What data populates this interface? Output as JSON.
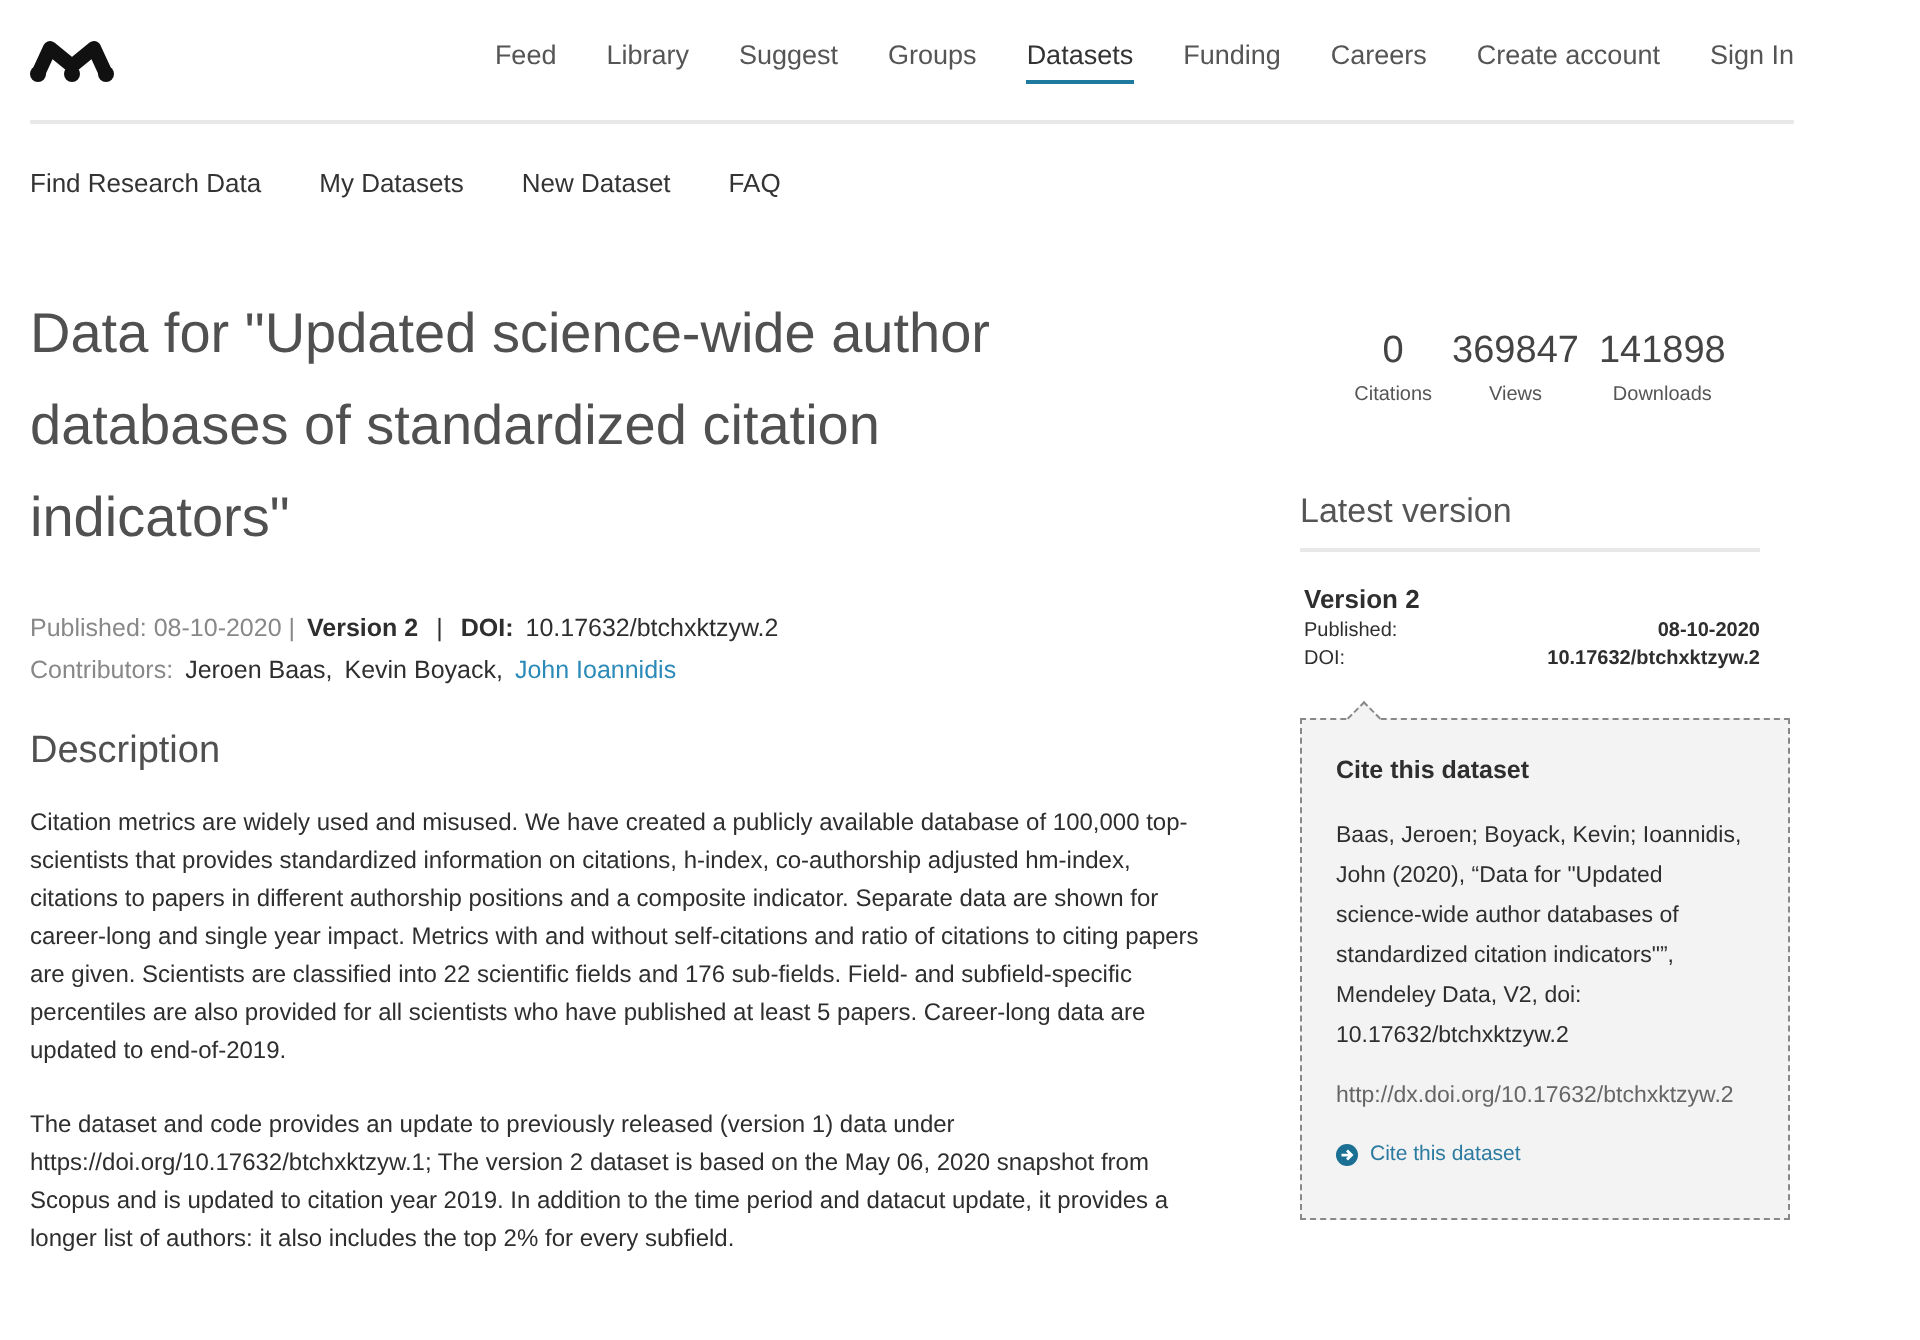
{
  "nav": [
    {
      "label": "Feed",
      "selected": false
    },
    {
      "label": "Library",
      "selected": false
    },
    {
      "label": "Suggest",
      "selected": false
    },
    {
      "label": "Groups",
      "selected": false
    },
    {
      "label": "Datasets",
      "selected": true
    },
    {
      "label": "Funding",
      "selected": false
    },
    {
      "label": "Careers",
      "selected": false
    },
    {
      "label": "Create account",
      "selected": false
    },
    {
      "label": "Sign In",
      "selected": false
    }
  ],
  "subnav": [
    "Find Research Data",
    "My Datasets",
    "New Dataset",
    "FAQ"
  ],
  "title": "Data for \"Updated science-wide author databases of standardized citation indicators\"",
  "meta": {
    "published": "Published: 08-10-2020 |",
    "version": "Version 2",
    "separator": "|",
    "doi_label": "DOI:",
    "doi": "10.17632/btchxktzyw.2",
    "contributors_label": "Contributors:",
    "contributors": [
      {
        "name": "Jeroen Baas,",
        "linked": false
      },
      {
        "name": "Kevin Boyack,",
        "linked": false
      },
      {
        "name": "John Ioannidis",
        "linked": true
      }
    ]
  },
  "description": {
    "heading": "Description",
    "paragraphs": [
      "Citation metrics are widely used and misused. We have created a publicly available database of 100,000 top-scientists that provides standardized information on citations, h-index, co-authorship adjusted hm-index, citations to papers in different authorship positions and a composite indicator. Separate data are shown for career-long and single year impact. Metrics with and without self-citations and ratio of citations to citing papers are given. Scientists are classified into 22 scientific fields and 176 sub-fields. Field- and subfield-specific percentiles are also provided for all scientists who have published at least 5 papers. Career-long data are updated to end-of-2019.",
      "The dataset and code provides an update to previously released (version 1) data under https://doi.org/10.17632/btchxktzyw.1; The version 2 dataset is based on the May 06, 2020 snapshot from Scopus and is updated to citation year 2019. In addition to the time period and datacut update, it provides a longer list of authors: it also includes the top 2% for every subfield."
    ]
  },
  "stats": [
    {
      "value": "0",
      "label": "Citations"
    },
    {
      "value": "369847",
      "label": "Views"
    },
    {
      "value": "141898",
      "label": "Downloads"
    }
  ],
  "latest": {
    "heading": "Latest version",
    "version": "Version 2",
    "rows": [
      {
        "label": "Published:",
        "value": "08-10-2020"
      },
      {
        "label": "DOI:",
        "value": "10.17632/btchxktzyw.2"
      }
    ]
  },
  "cite": {
    "heading": "Cite this dataset",
    "citation": "Baas, Jeroen; Boyack, Kevin; Ioannidis, John (2020), “Data for \"Updated science-wide author databases of standardized citation indicators\"”, Mendeley Data, V2, doi: 10.17632/btchxktzyw.2",
    "url": "http://dx.doi.org/10.17632/btchxktzyw.2",
    "link": "Cite this dataset"
  }
}
